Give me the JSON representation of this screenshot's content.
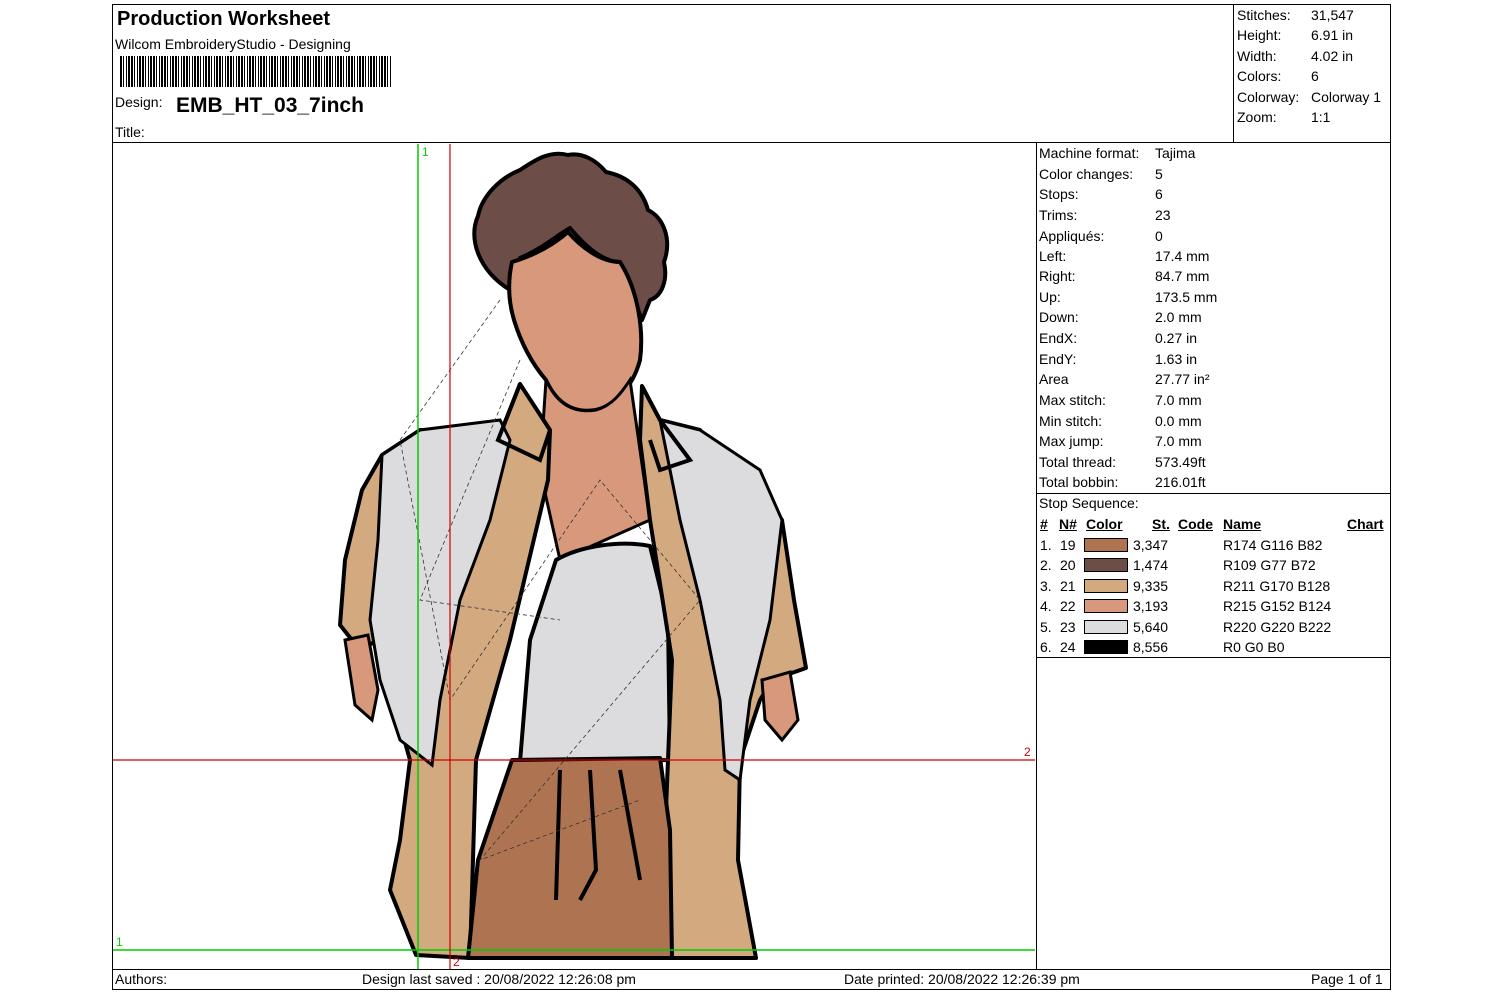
{
  "header": {
    "title": "Production Worksheet",
    "software": "Wilcom EmbroideryStudio - Designing",
    "design_label": "Design:",
    "design_name": "EMB_HT_03_7inch",
    "title_label": "Title:"
  },
  "summary": [
    {
      "label": "Stitches:",
      "value": "31,547"
    },
    {
      "label": "Height:",
      "value": "6.91 in"
    },
    {
      "label": "Width:",
      "value": "4.02 in"
    },
    {
      "label": "Colors:",
      "value": "6"
    },
    {
      "label": "Colorway:",
      "value": "Colorway 1"
    },
    {
      "label": "Zoom:",
      "value": "1:1"
    }
  ],
  "details": [
    {
      "label": "Machine format:",
      "value": "Tajima"
    },
    {
      "label": "Color changes:",
      "value": "5"
    },
    {
      "label": "Stops:",
      "value": "6"
    },
    {
      "label": "Trims:",
      "value": "23"
    },
    {
      "label": "Appliqués:",
      "value": "0"
    },
    {
      "label": "Left:",
      "value": "17.4 mm"
    },
    {
      "label": "Right:",
      "value": "84.7 mm"
    },
    {
      "label": "Up:",
      "value": "173.5 mm"
    },
    {
      "label": "Down:",
      "value": "2.0 mm"
    },
    {
      "label": "EndX:",
      "value": "0.27 in"
    },
    {
      "label": "EndY:",
      "value": "1.63 in"
    },
    {
      "label": "Area",
      "value": " 27.77 in²"
    },
    {
      "label": "Max stitch:",
      "value": "7.0 mm"
    },
    {
      "label": "Min stitch:",
      "value": "0.0 mm"
    },
    {
      "label": "Max jump:",
      "value": "7.0 mm"
    },
    {
      "label": "Total thread:",
      "value": "573.49ft"
    },
    {
      "label": "Total bobbin:",
      "value": "216.01ft"
    }
  ],
  "stop_sequence": {
    "title": "Stop Sequence:",
    "headers": {
      "num": "#",
      "n": "N#",
      "color": "Color",
      "st": "St.",
      "code": "Code",
      "name": "Name",
      "chart": "Chart"
    },
    "rows": [
      {
        "num": "1.",
        "n": "19",
        "color": "#AE7452",
        "stitches": "3,347",
        "name": "R174 G116 B82"
      },
      {
        "num": "2.",
        "n": "20",
        "color": "#6D4D48",
        "stitches": "1,474",
        "name": "R109 G77 B72"
      },
      {
        "num": "3.",
        "n": "21",
        "color": "#D3AA80",
        "stitches": "9,335",
        "name": "R211 G170 B128"
      },
      {
        "num": "4.",
        "n": "22",
        "color": "#D7987C",
        "stitches": "3,193",
        "name": "R215 G152 B124"
      },
      {
        "num": "5.",
        "n": "23",
        "color": "#DCDCDE",
        "stitches": "5,640",
        "name": "R220 G220 B222"
      },
      {
        "num": "6.",
        "n": "24",
        "color": "#000000",
        "stitches": "8,556",
        "name": "R0 G0 B0"
      }
    ]
  },
  "footer": {
    "authors": "Authors:",
    "saved": "Design last saved : 20/08/2022 12:26:08 pm",
    "printed": "Date printed: 20/08/2022 12:26:39 pm",
    "page": "Page 1 of 1"
  },
  "guides": {
    "green_v": "1",
    "green_h": "1",
    "red_h": "2",
    "red_v": "2",
    "green_color": "#00CC00",
    "red_color": "#CC0000"
  },
  "colors": {
    "tan": "#D3AA80",
    "brown": "#AE7452",
    "hair": "#6D4D48",
    "skin": "#D7987C",
    "shirt": "#DCDCDE",
    "outline": "#000000"
  }
}
